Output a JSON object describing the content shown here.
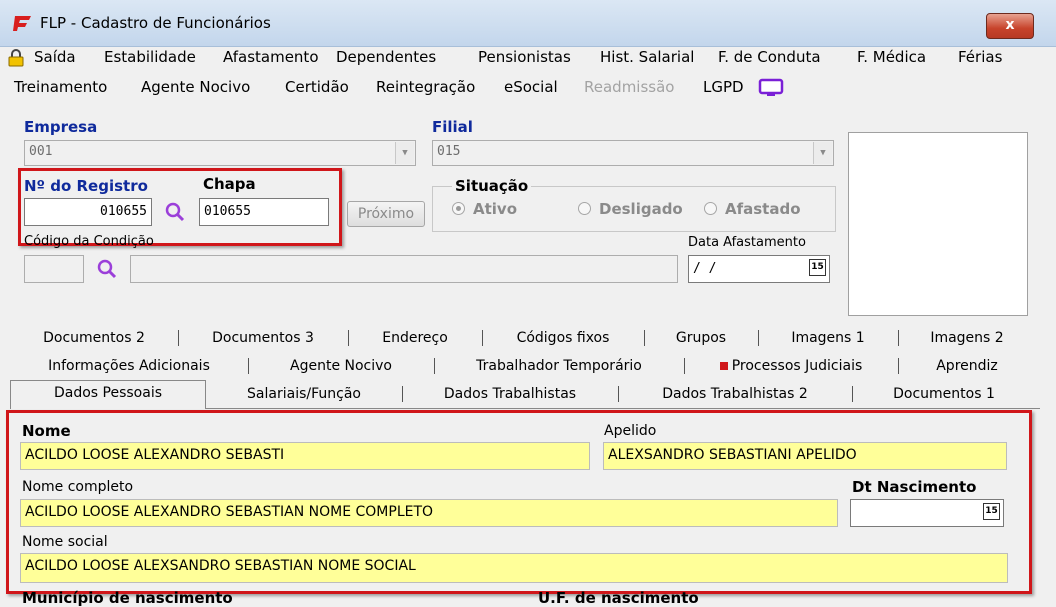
{
  "window": {
    "title": "FLP - Cadastro de Funcionários",
    "close_label": "x"
  },
  "menu": {
    "row1": [
      "Saída",
      "Estabilidade",
      "Afastamento",
      "Dependentes",
      "Pensionistas",
      "Hist. Salarial",
      "F. de Conduta",
      "F. Médica",
      "Férias"
    ],
    "row2": [
      "Treinamento",
      "Agente Nocivo",
      "Certidão",
      "Reintegração",
      "eSocial",
      "Readmissão",
      "LGPD"
    ]
  },
  "header": {
    "empresa_label": "Empresa",
    "empresa_value": "001",
    "filial_label": "Filial",
    "filial_value": "015",
    "registro_label": "Nº do Registro",
    "registro_value": "010655",
    "chapa_label": "Chapa",
    "chapa_value": "010655",
    "proximo_label": "Próximo",
    "situacao_label": "Situação",
    "situacao_options": [
      "Ativo",
      "Desligado",
      "Afastado"
    ],
    "situacao_selected": "Ativo",
    "codigo_condicao_label": "Código da Condição",
    "data_afastamento_label": "Data Afastamento",
    "data_afastamento_value": "/ /",
    "calendar_day": "15"
  },
  "tabs": {
    "row1": [
      "Documentos 2",
      "Documentos 3",
      "Endereço",
      "Códigos fixos",
      "Grupos",
      "Imagens 1",
      "Imagens 2"
    ],
    "row2": [
      "Informações Adicionais",
      "Agente Nocivo",
      "Trabalhador Temporário",
      "Processos Judiciais",
      "Aprendiz"
    ],
    "row3": [
      "Dados Pessoais",
      "Salariais/Função",
      "Dados Trabalhistas",
      "Dados Trabalhistas 2",
      "Documentos 1"
    ],
    "active": "Dados Pessoais"
  },
  "pessoais": {
    "nome_label": "Nome",
    "nome_value": "ACILDO LOOSE ALEXANDRO SEBASTI",
    "apelido_label": "Apelido",
    "apelido_value": "ALEXSANDRO SEBASTIANI APELIDO",
    "nome_completo_label": "Nome completo",
    "nome_completo_value": "ACILDO LOOSE ALEXANDRO SEBASTIAN NOME COMPLETO",
    "dt_nascimento_label": "Dt Nascimento",
    "nome_social_label": "Nome social",
    "nome_social_value": "ACILDO LOOSE ALEXSANDRO SEBASTIAN NOME SOCIAL",
    "municipio_label": "Município de nascimento",
    "uf_label": "U.F. de nascimento"
  },
  "colors": {
    "highlight": "#d0161a",
    "field_yellow": "#ffff99",
    "label_blue": "#0f2a9c",
    "lgpd_purple": "#7a1fd6"
  }
}
